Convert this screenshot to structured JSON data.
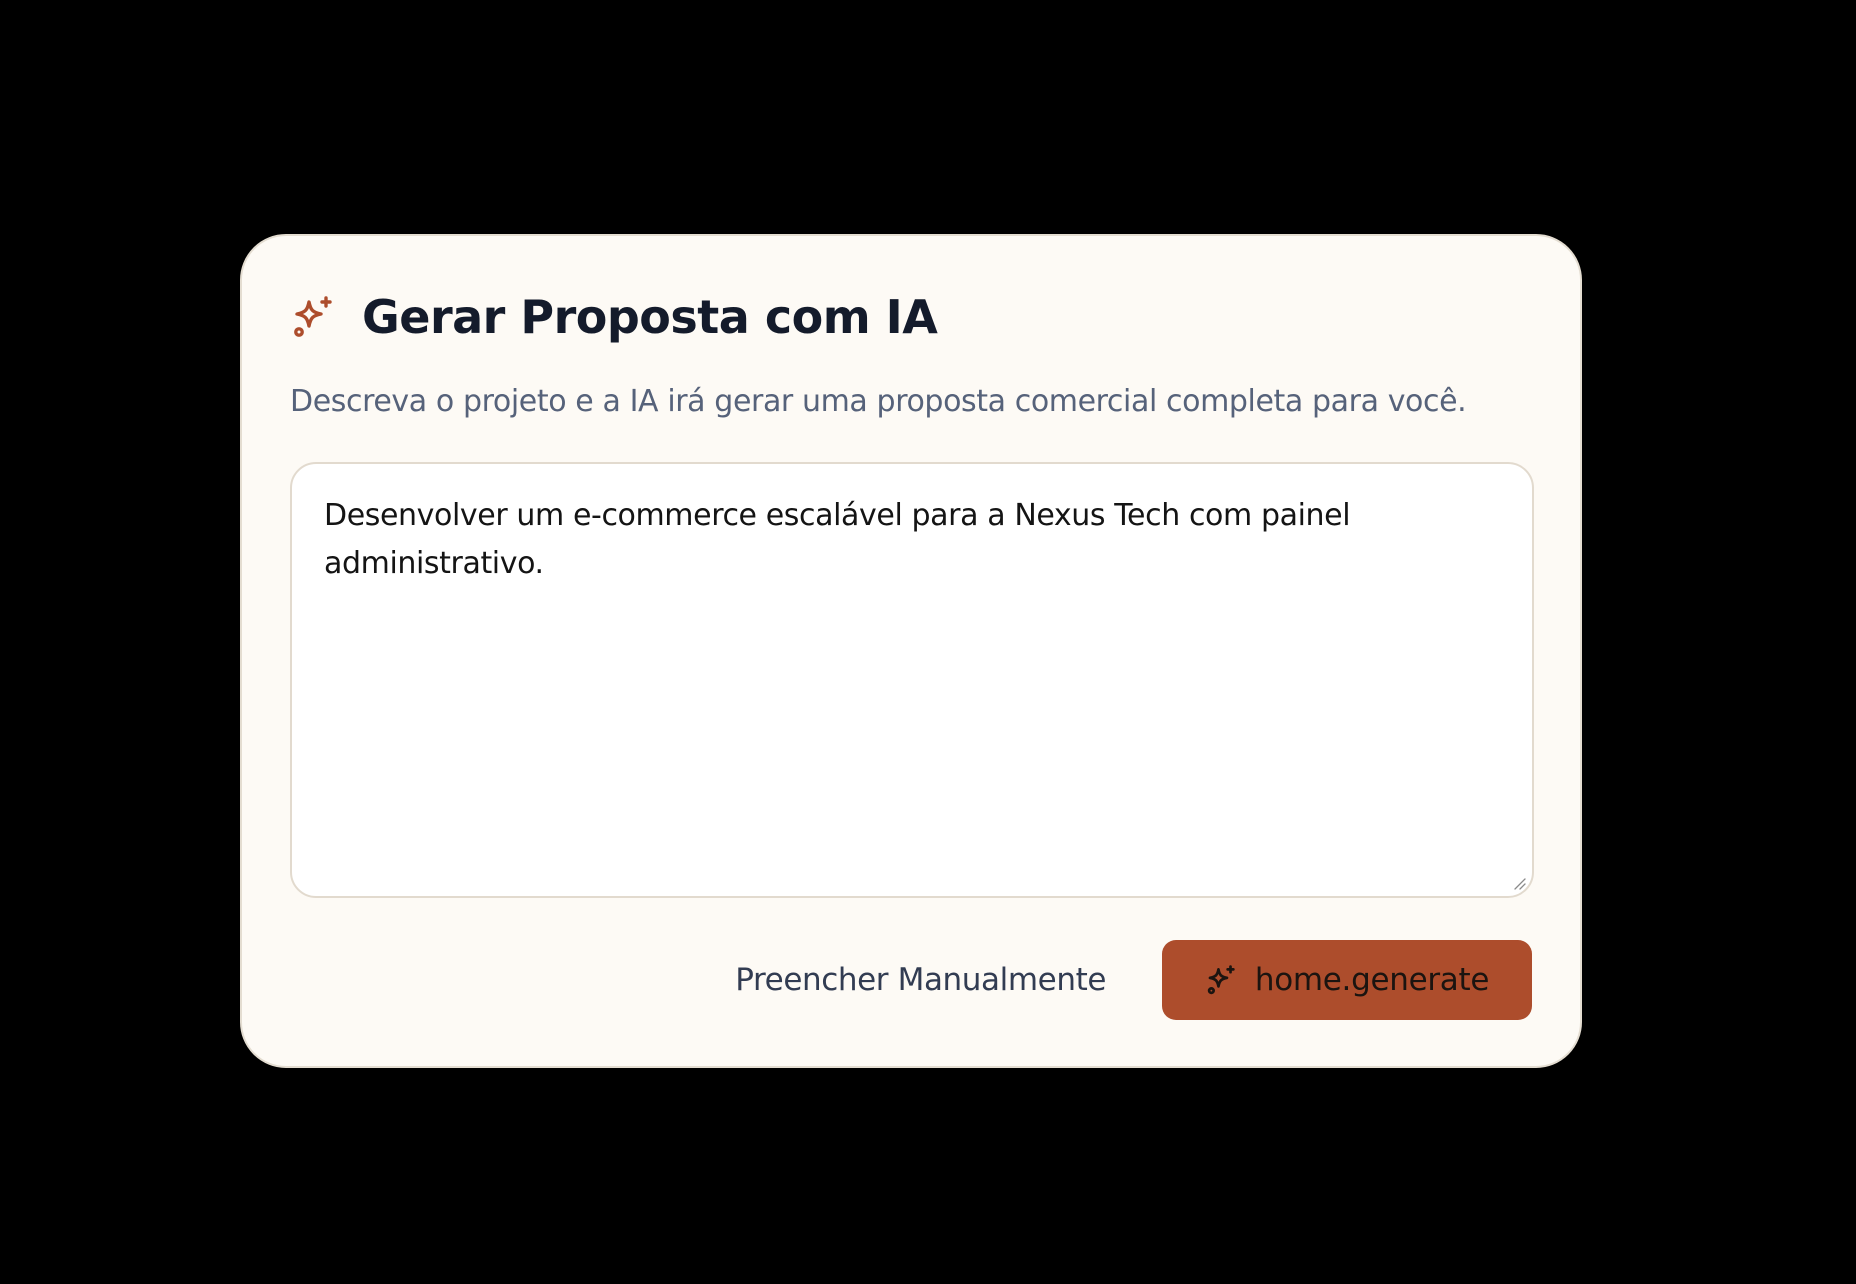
{
  "dialog": {
    "title": "Gerar Proposta com IA",
    "subtitle": "Descreva o projeto e a IA irá gerar uma proposta comercial completa para você.",
    "title_icon": "sparkles-icon",
    "description_value": "Desenvolver um e-commerce escalável para a Nexus Tech com painel administrativo.",
    "manual_button_label": "Preencher Manualmente",
    "generate_button_label": "home.generate",
    "generate_button_icon": "sparkles-icon"
  },
  "colors": {
    "backdrop": "#000000",
    "card_background": "#fdfaf5",
    "accent": "#ad4d2c",
    "title_text": "#141b2b",
    "subtitle_text": "#56627a"
  }
}
